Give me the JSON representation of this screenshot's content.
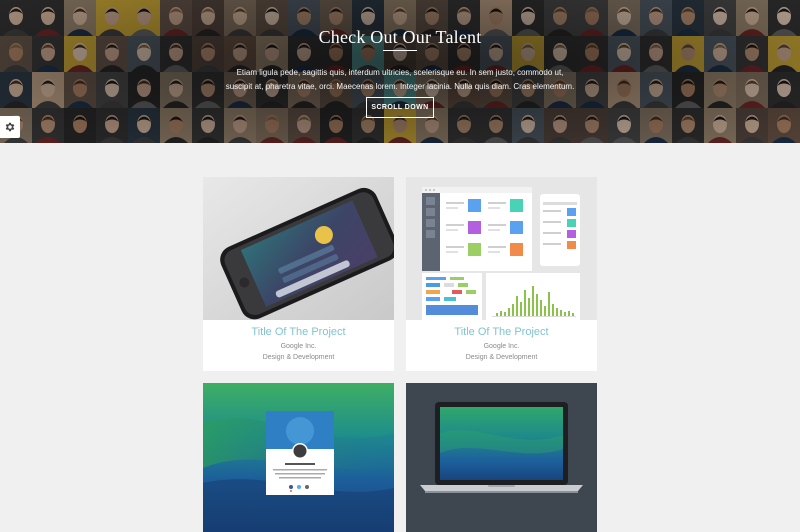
{
  "hero": {
    "title": "Check Out Our Talent",
    "text": "Etiam ligula pede, sagittis quis, interdum ultricies, scelerisque eu. In sem justo, commodo ut, suscipit at, pharetra vitae, orci. Maecenas lorem. Integer lacinia. Nulla quis diam. Cras elementum.",
    "button_label": "SCROLL DOWN"
  },
  "settings": {
    "icon": "gear-icon"
  },
  "projects": [
    {
      "title": "Title Of The Project",
      "company": "Google Inc.",
      "category": "Design & Development"
    },
    {
      "title": "Title Of The Project",
      "company": "Google Inc.",
      "category": "Design & Development"
    }
  ],
  "colors": {
    "accent": "#7fc4cf",
    "page_bg": "#f0f0f0",
    "card_bg": "#ffffff"
  }
}
